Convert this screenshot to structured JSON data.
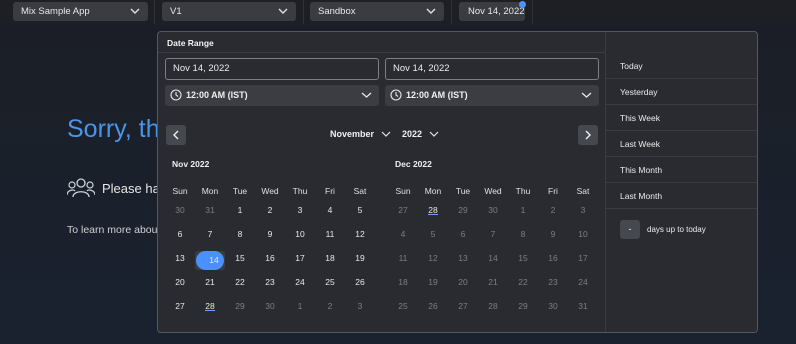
{
  "topbar": {
    "app_select": "Mix Sample App",
    "version_select": "V1",
    "env_select": "Sandbox",
    "date_button": "Nov 14, 2022"
  },
  "background": {
    "heading": "Sorry, the",
    "line1": "Please hav",
    "line2": "To learn more about t"
  },
  "date_range": {
    "title": "Date Range",
    "start_date": "Nov 14, 2022",
    "end_date": "Nov 14, 2022",
    "start_time": "12:00 AM (IST)",
    "end_time": "12:00 AM (IST)",
    "month_picker": "November",
    "year_picker": "2022",
    "left_month_label": "Nov 2022",
    "right_month_label": "Dec 2022",
    "weekdays": [
      "Sun",
      "Mon",
      "Tue",
      "Wed",
      "Thu",
      "Fri",
      "Sat"
    ],
    "nov_weeks": [
      [
        {
          "d": "30",
          "dim": true
        },
        {
          "d": "31",
          "dim": true
        },
        {
          "d": "1"
        },
        {
          "d": "2"
        },
        {
          "d": "3"
        },
        {
          "d": "4"
        },
        {
          "d": "5"
        }
      ],
      [
        {
          "d": "6"
        },
        {
          "d": "7"
        },
        {
          "d": "8"
        },
        {
          "d": "9"
        },
        {
          "d": "10"
        },
        {
          "d": "11"
        },
        {
          "d": "12"
        }
      ],
      [
        {
          "d": "13"
        },
        {
          "d": "14",
          "selected": true
        },
        {
          "d": "15"
        },
        {
          "d": "16"
        },
        {
          "d": "17"
        },
        {
          "d": "18"
        },
        {
          "d": "19"
        }
      ],
      [
        {
          "d": "20"
        },
        {
          "d": "21"
        },
        {
          "d": "22"
        },
        {
          "d": "23"
        },
        {
          "d": "24"
        },
        {
          "d": "25"
        },
        {
          "d": "26"
        }
      ],
      [
        {
          "d": "27"
        },
        {
          "d": "28",
          "underline": true
        },
        {
          "d": "29",
          "dim": true
        },
        {
          "d": "30",
          "dim": true
        },
        {
          "d": "1",
          "dim": true
        },
        {
          "d": "2",
          "dim": true
        },
        {
          "d": "3",
          "dim": true
        }
      ]
    ],
    "dec_weeks": [
      [
        {
          "d": "27",
          "dim": true
        },
        {
          "d": "28",
          "underline": true
        },
        {
          "d": "29",
          "dim": true
        },
        {
          "d": "30",
          "dim": true
        },
        {
          "d": "1",
          "dim": true
        },
        {
          "d": "2",
          "dim": true
        },
        {
          "d": "3",
          "dim": true
        }
      ],
      [
        {
          "d": "4",
          "dim": true
        },
        {
          "d": "5",
          "dim": true
        },
        {
          "d": "6",
          "dim": true
        },
        {
          "d": "7",
          "dim": true
        },
        {
          "d": "8",
          "dim": true
        },
        {
          "d": "9",
          "dim": true
        },
        {
          "d": "10",
          "dim": true
        }
      ],
      [
        {
          "d": "11",
          "dim": true
        },
        {
          "d": "12",
          "dim": true
        },
        {
          "d": "13",
          "dim": true
        },
        {
          "d": "14",
          "dim": true
        },
        {
          "d": "15",
          "dim": true
        },
        {
          "d": "16",
          "dim": true
        },
        {
          "d": "17",
          "dim": true
        }
      ],
      [
        {
          "d": "18",
          "dim": true
        },
        {
          "d": "19",
          "dim": true
        },
        {
          "d": "20",
          "dim": true
        },
        {
          "d": "21",
          "dim": true
        },
        {
          "d": "22",
          "dim": true
        },
        {
          "d": "23",
          "dim": true
        },
        {
          "d": "24",
          "dim": true
        }
      ],
      [
        {
          "d": "25",
          "dim": true
        },
        {
          "d": "26",
          "dim": true
        },
        {
          "d": "27",
          "dim": true
        },
        {
          "d": "28",
          "dim": true
        },
        {
          "d": "29",
          "dim": true
        },
        {
          "d": "30",
          "dim": true
        },
        {
          "d": "31",
          "dim": true
        }
      ]
    ],
    "presets": [
      "Today",
      "Yesterday",
      "This Week",
      "Last Week",
      "This Month",
      "Last Month"
    ],
    "days_value": "-",
    "days_label": "days up to today"
  },
  "colors": {
    "accent": "#4a90ff",
    "heading": "#4a95e8"
  }
}
